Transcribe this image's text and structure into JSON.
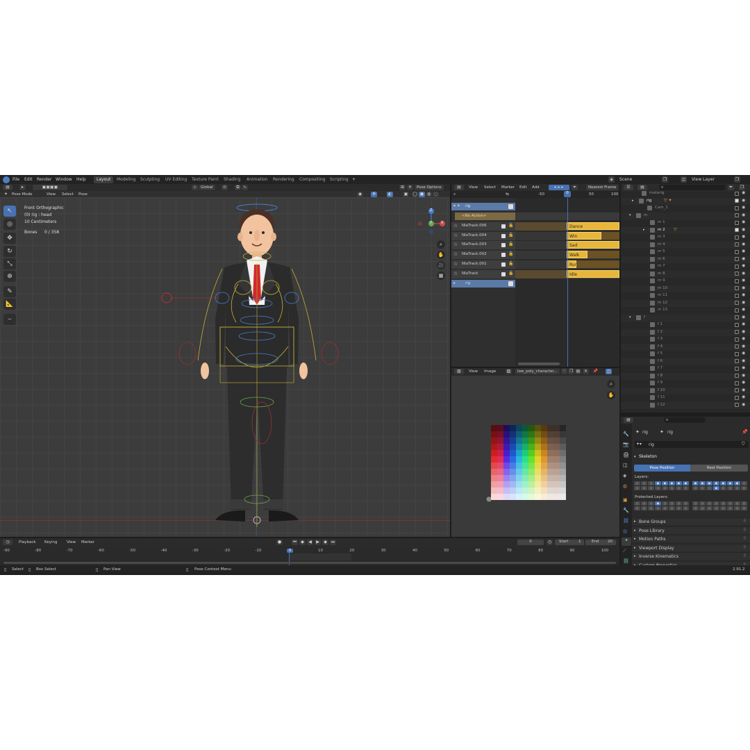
{
  "topbar": {
    "menus": [
      "File",
      "Edit",
      "Render",
      "Window",
      "Help"
    ],
    "workspaces": [
      "Layout",
      "Modeling",
      "Sculpting",
      "UV Editing",
      "Texture Paint",
      "Shading",
      "Animation",
      "Rendering",
      "Compositing",
      "Scripting"
    ],
    "active_workspace": "Layout",
    "add_tab": "+",
    "scene_label": "Scene",
    "view_layer_label": "View Layer"
  },
  "viewport": {
    "transform_orientation": "Global",
    "pose_options": "Pose Options",
    "mode": "Pose Mode",
    "menus": [
      "View",
      "Select",
      "Pose"
    ],
    "overlay_title": "Front Orthographic",
    "overlay_object": "(0) rig : head",
    "overlay_scale": "10 Centimeters",
    "bones_label": "Bones",
    "bones_value": "0 / 358",
    "axis_x": "X",
    "axis_y": "Y",
    "axis_z": "Z"
  },
  "nla": {
    "menus": [
      "View",
      "Select",
      "Marker",
      "Edit",
      "Add"
    ],
    "snap": "Nearest Frame",
    "ruler": [
      "-50",
      "0",
      "50",
      "100"
    ],
    "current_frame": "0",
    "rig_label": "rig",
    "no_action": "<No Action>",
    "tracks": [
      "NlaTrack.006",
      "NlaTrack.004",
      "NlaTrack.003",
      "NlaTrack.002",
      "NlaTrack.001",
      "NlaTrack"
    ],
    "strips": [
      "Dance",
      "Win",
      "Sad",
      "Walk",
      "Run",
      "Idle"
    ],
    "rig2_label": "rig"
  },
  "image_editor": {
    "menus": [
      "View",
      "Image"
    ],
    "image_name": "low_poly_character..."
  },
  "outliner": {
    "rows": [
      "metarig",
      "rig",
      "Cam_1",
      "m",
      "m 1",
      "m 2",
      "m 3",
      "m 4",
      "m 5",
      "m 6",
      "m 7",
      "m 8",
      "m 9",
      "m 10",
      "m 11",
      "m 12",
      "m 13",
      "f",
      "f 1",
      "f 2",
      "f 3",
      "f 4",
      "f 5",
      "f 6",
      "f 7",
      "f 8",
      "f 9",
      "f 10",
      "f 11",
      "f 12"
    ]
  },
  "properties": {
    "breadcrumb_a": "rig",
    "breadcrumb_b": "rig",
    "data_name": "rig",
    "skeleton_header": "Skeleton",
    "pose_position": "Pose Position",
    "rest_position": "Rest Position",
    "layers_label": "Layers:",
    "protected_layers_label": "Protected Layers:",
    "panels": [
      "Bone Groups",
      "Pose Library",
      "Motion Paths",
      "Viewport Display",
      "Inverse Kinematics",
      "Custom Properties"
    ]
  },
  "timeline": {
    "menus": [
      "Playback",
      "Keying",
      "View",
      "Marker"
    ],
    "current_frame": "0",
    "start_label": "Start",
    "start_value": "1",
    "end_label": "End",
    "end_value": "20",
    "ruler": [
      "-90",
      "-80",
      "-70",
      "-60",
      "-50",
      "-40",
      "-30",
      "-20",
      "-10",
      "0",
      "10",
      "20",
      "30",
      "40",
      "50",
      "60",
      "70",
      "80",
      "90",
      "100"
    ]
  },
  "statusbar": {
    "select": "Select",
    "box_select": "Box Select",
    "pan_view": "Pan View",
    "context_menu": "Pose Context Menu",
    "version": "2.91.2"
  },
  "colors": {
    "accent": "#4772b3",
    "strip": "#e8b63a",
    "panel_bg": "#2b2b2b"
  }
}
